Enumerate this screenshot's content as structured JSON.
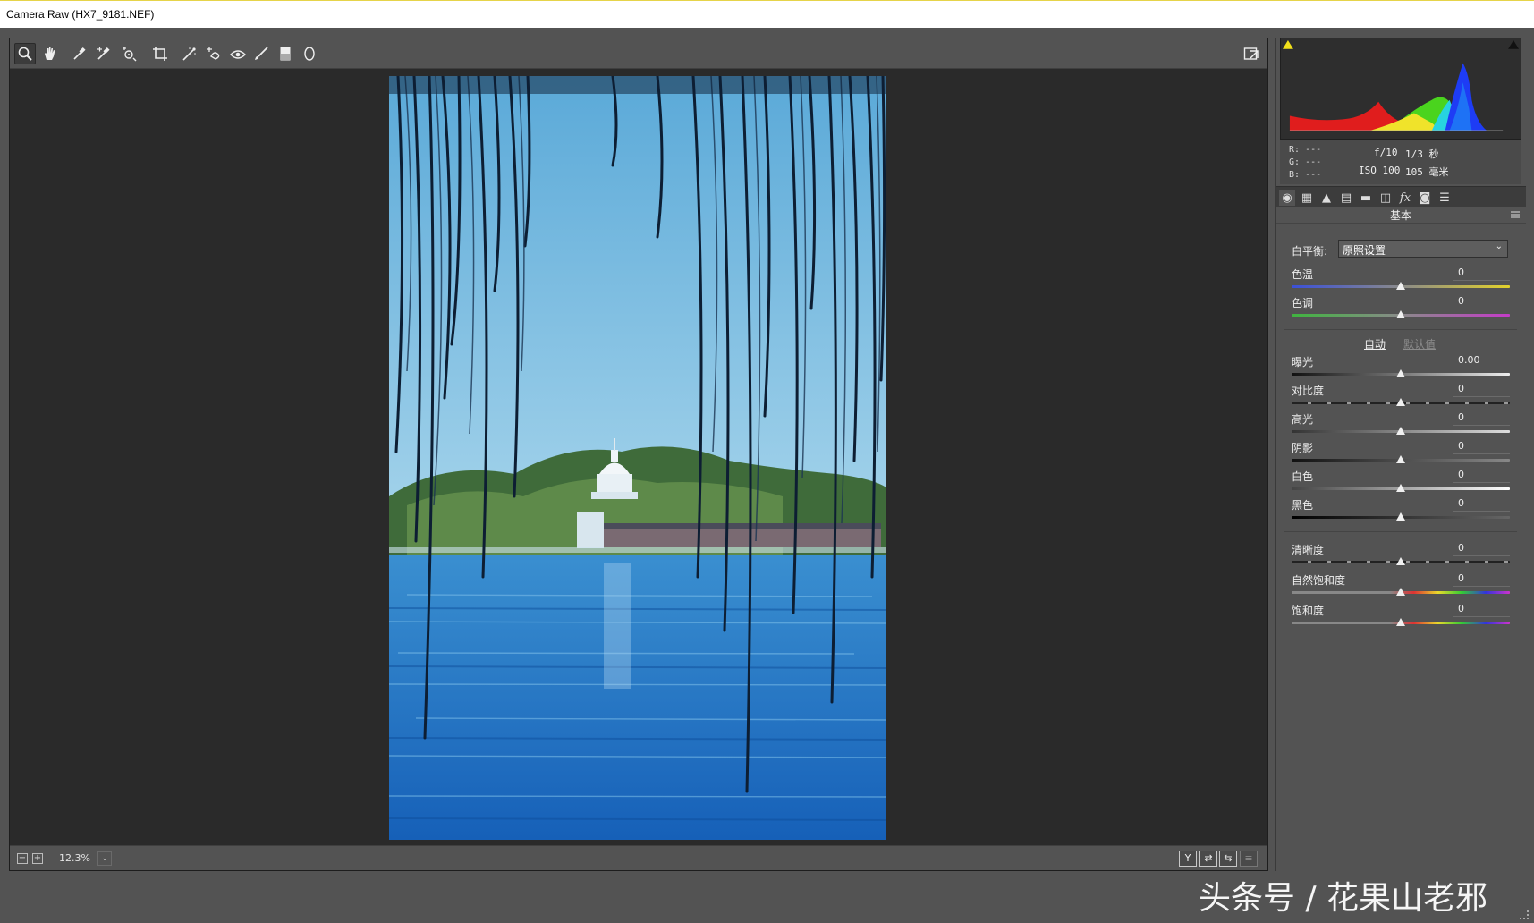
{
  "window": {
    "title": "Camera Raw (HX7_9181.NEF)"
  },
  "toolbar": {
    "tools": [
      {
        "name": "zoom-tool",
        "icon": "magnifier-icon",
        "active": true
      },
      {
        "name": "hand-tool",
        "icon": "hand-icon"
      },
      {
        "name": "white-balance-tool",
        "icon": "eyedropper-icon"
      },
      {
        "name": "color-sampler-tool",
        "icon": "eyedropper-plus-icon"
      },
      {
        "name": "targeted-adjustment-tool",
        "icon": "target-icon"
      },
      {
        "name": "crop-tool",
        "icon": "crop-icon"
      },
      {
        "name": "straighten-tool",
        "icon": "straighten-icon"
      },
      {
        "name": "spot-removal-tool",
        "icon": "spot-heal-icon"
      },
      {
        "name": "red-eye-tool",
        "icon": "red-eye-icon"
      },
      {
        "name": "adjustment-brush-tool",
        "icon": "brush-icon"
      },
      {
        "name": "graduated-filter-tool",
        "icon": "gradient-rect-icon"
      },
      {
        "name": "radial-filter-tool",
        "icon": "ellipse-icon"
      }
    ],
    "fullscreen_icon": "fullscreen-toggle-icon"
  },
  "status": {
    "zoom_minus": "−",
    "zoom_plus": "+",
    "zoom_level": "12.3%",
    "zoom_dropdown": "⌄",
    "view_buttons": [
      "Y",
      "⇄",
      "⇆",
      "≡"
    ]
  },
  "histogram": {
    "rgb": {
      "r_label": "R:",
      "g_label": "G:",
      "b_label": "B:",
      "r": "---",
      "g": "---",
      "b": "---"
    },
    "exif": {
      "aperture": "f/10",
      "shutter": "1/3 秒",
      "iso": "ISO 100",
      "focal": "105 毫米"
    }
  },
  "panel_tabs": [
    "basic-icon",
    "tone-curve-icon",
    "detail-icon",
    "hsl-icon",
    "split-toning-icon",
    "lens-icon",
    "fx-icon",
    "camera-calibration-icon",
    "presets-icon"
  ],
  "basic": {
    "section_title": "基本",
    "white_balance": {
      "label": "白平衡:",
      "value": "原照设置",
      "dd": "⌄"
    },
    "auto_label": "自动",
    "default_label": "默认值",
    "sliders_wb": [
      {
        "key": "temp",
        "label": "色温",
        "value": "0",
        "pos": 0.5
      },
      {
        "key": "tint",
        "label": "色调",
        "value": "0",
        "pos": 0.5
      }
    ],
    "sliders_tone": [
      {
        "key": "exposure",
        "label": "曝光",
        "value": "0.00",
        "pos": 0.5
      },
      {
        "key": "contrast",
        "label": "对比度",
        "value": "0",
        "pos": 0.5
      },
      {
        "key": "highlights",
        "label": "高光",
        "value": "0",
        "pos": 0.5
      },
      {
        "key": "shadows",
        "label": "阴影",
        "value": "0",
        "pos": 0.5
      },
      {
        "key": "whites",
        "label": "白色",
        "value": "0",
        "pos": 0.5
      },
      {
        "key": "blacks",
        "label": "黑色",
        "value": "0",
        "pos": 0.5
      }
    ],
    "sliders_presence": [
      {
        "key": "clarity",
        "label": "清晰度",
        "value": "0",
        "pos": 0.5
      },
      {
        "key": "vibrance",
        "label": "自然饱和度",
        "value": "0",
        "pos": 0.5
      },
      {
        "key": "saturation",
        "label": "饱和度",
        "value": "0",
        "pos": 0.5
      }
    ]
  },
  "watermark": "头条号 / 花果山老邪",
  "colors": {
    "accent_yellow": "#e6d44a",
    "panel_bg": "#535353",
    "preview_bg": "#2a2a2a"
  }
}
